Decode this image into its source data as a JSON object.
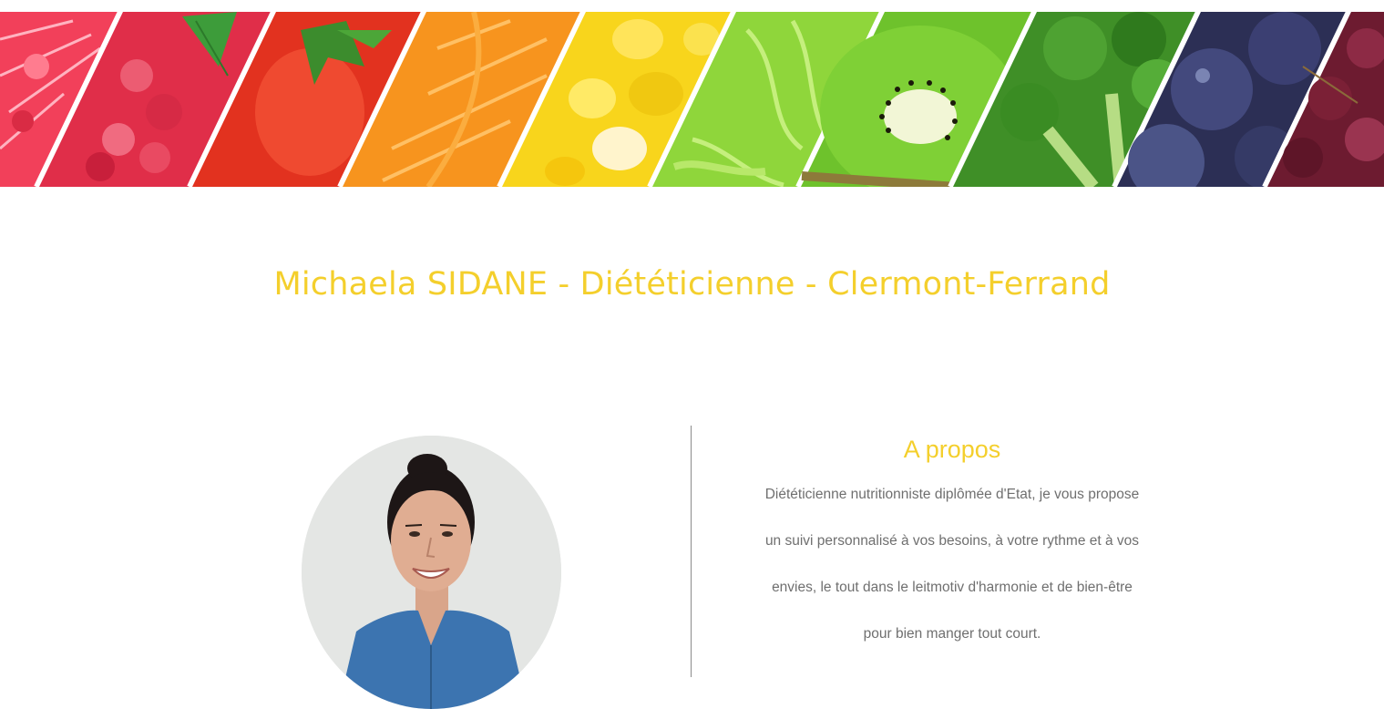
{
  "banner": {
    "fruits": [
      {
        "name": "grapefruit-slice",
        "color": "#f2405a"
      },
      {
        "name": "raspberries",
        "color": "#e8364e"
      },
      {
        "name": "tomato",
        "color": "#e2321f"
      },
      {
        "name": "orange-slices",
        "color": "#f7941e"
      },
      {
        "name": "corn-kernels",
        "color": "#f8d51c"
      },
      {
        "name": "lettuce",
        "color": "#8fd63b"
      },
      {
        "name": "kiwi-slice",
        "color": "#5fb81f"
      },
      {
        "name": "broccoli",
        "color": "#3f8f27"
      },
      {
        "name": "plums",
        "color": "#3b3f72"
      },
      {
        "name": "red-grapes",
        "color": "#7b2036"
      }
    ]
  },
  "header": {
    "title": "Michaela SIDANE - Diététicienne - Clermont-Ferrand"
  },
  "about": {
    "heading": "A propos",
    "lines": [
      "Diététicienne nutritionniste diplômée d'Etat, je vous propose",
      "un suivi personnalisé à vos besoins, à votre rythme et à vos",
      "envies, le tout dans le leitmotiv d'harmonie et de bien-être",
      "pour bien manger tout court."
    ]
  },
  "colors": {
    "accent": "#f4cf2c",
    "body_text": "#6f6f6f",
    "divider": "#8b8b8b"
  }
}
